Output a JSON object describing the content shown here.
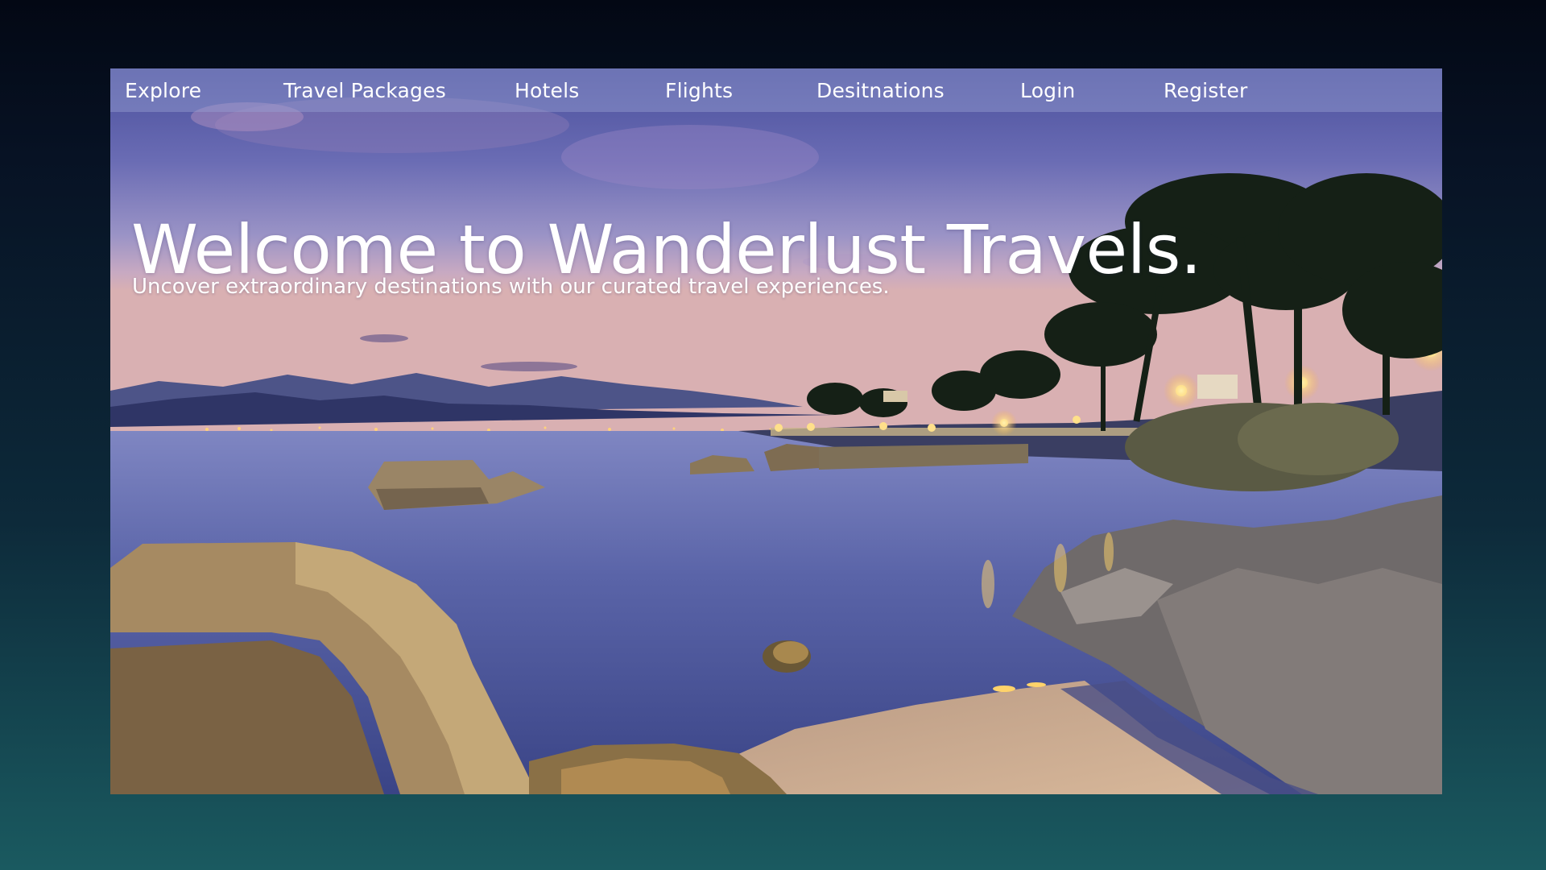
{
  "nav": {
    "items": [
      {
        "label": "Explore"
      },
      {
        "label": "Travel Packages"
      },
      {
        "label": "Hotels"
      },
      {
        "label": "Flights"
      },
      {
        "label": "Desitnations"
      },
      {
        "label": "Login"
      },
      {
        "label": "Register"
      }
    ]
  },
  "hero": {
    "title": "Welcome to Wanderlust Travels.",
    "subtitle": "Uncover extraordinary destinations with our curated travel experiences."
  },
  "colors": {
    "page_gradient_top": "#030814",
    "page_gradient_bottom": "#1a5a60",
    "nav_bar": "rgba(150,160,210,0.45)",
    "text": "#ffffff"
  },
  "background_image": "coastal-sunset-photo"
}
